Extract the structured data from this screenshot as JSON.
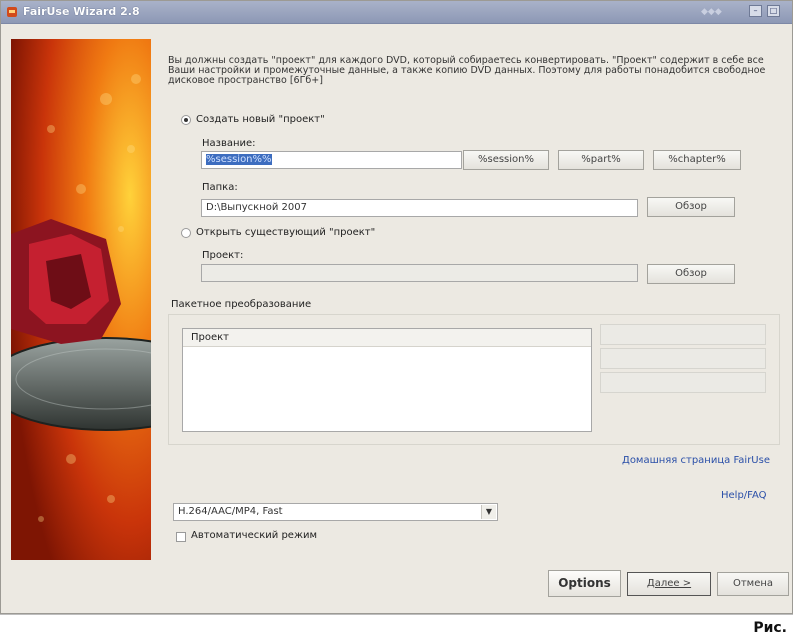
{
  "window": {
    "title": "FairUse Wizard 2.8",
    "minimize_icon": "minimize-icon",
    "close_icon": "close-icon"
  },
  "intro": "Вы должны создать \"проект\" для каждого DVD, который собираетесь конвертировать. \"Проект\" содержит в себе все Ваши настройки и промежуточные данные, а также копию DVD данных. Поэтому для работы понадобится свободное дисковое пространство [6Гб+]",
  "new_project": {
    "radio_label": "Создать новый \"проект\"",
    "name_label": "Название:",
    "name_value": "%session%%",
    "tokens": [
      "%session%",
      "%part%",
      "%chapter%"
    ],
    "folder_label": "Папка:",
    "folder_value": "D:\\Выпускной 2007",
    "browse_label": "Обзор"
  },
  "open_project": {
    "radio_label": "Открыть существующий \"проект\"",
    "project_label": "Проект:",
    "browse_label": "Обзор"
  },
  "batch": {
    "label": "Пакетное преобразование",
    "column_header": "Проект"
  },
  "links": {
    "homepage": "Домашняя страница FairUse",
    "help": "Help/FAQ"
  },
  "profile": {
    "selected": "H.264/AAC/MP4, Fast"
  },
  "auto_mode_label": "Автоматический режим",
  "buttons": {
    "options": "Options",
    "next": "Далее >",
    "cancel": "Отмена"
  },
  "caption": "Рис."
}
